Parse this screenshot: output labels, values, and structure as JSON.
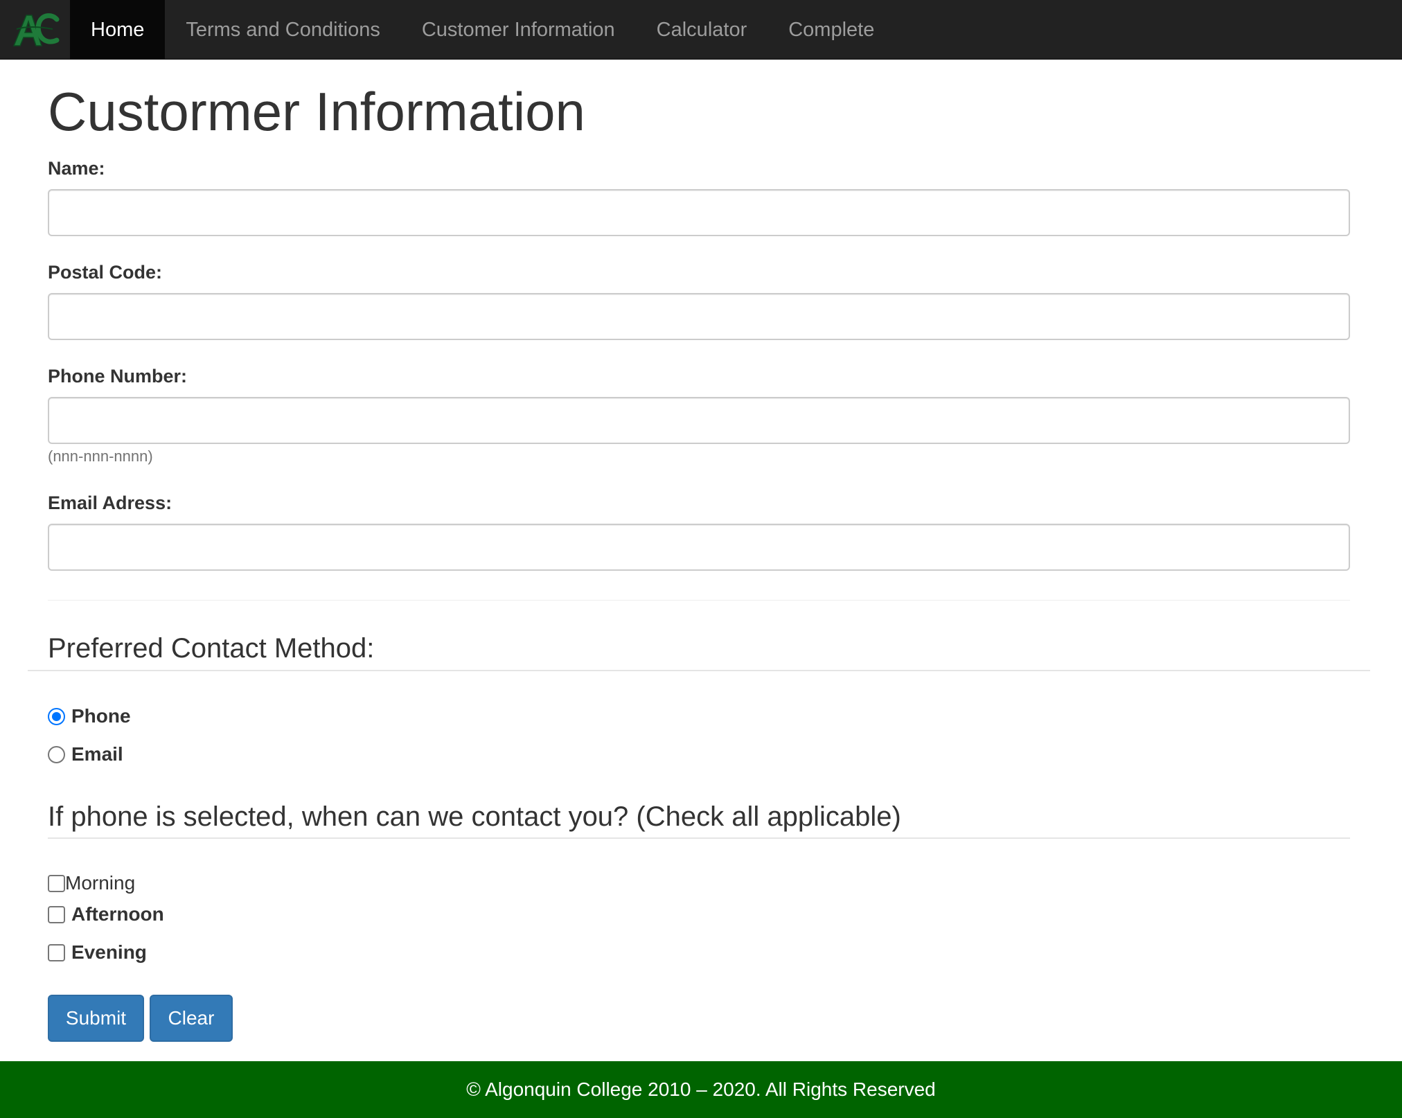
{
  "navbar": {
    "logo_alt": "AC",
    "items": [
      {
        "label": "Home",
        "active": true
      },
      {
        "label": "Terms and Conditions",
        "active": false
      },
      {
        "label": "Customer Information",
        "active": false
      },
      {
        "label": "Calculator",
        "active": false
      },
      {
        "label": "Complete",
        "active": false
      }
    ]
  },
  "page": {
    "title": "Custormer Information"
  },
  "form": {
    "name_label": "Name:",
    "name_value": "",
    "postal_label": "Postal Code:",
    "postal_value": "",
    "phone_label": "Phone Number:",
    "phone_value": "",
    "phone_help": "(nnn-nnn-nnnn)",
    "email_label": "Email Adress:",
    "email_value": ""
  },
  "contact_method": {
    "heading": "Preferred Contact Method:",
    "options": [
      {
        "label": "Phone",
        "checked": true
      },
      {
        "label": "Email",
        "checked": false
      }
    ]
  },
  "contact_times": {
    "heading": "If phone is selected, when can we contact you? (Check all applicable)",
    "options": [
      {
        "label": "Morning",
        "checked": false
      },
      {
        "label": "Afternoon",
        "checked": false
      },
      {
        "label": "Evening",
        "checked": false
      }
    ]
  },
  "buttons": {
    "submit_label": "Submit",
    "clear_label": "Clear"
  },
  "footer": {
    "text": "© Algonquin College 2010 – 2020. All Rights Reserved"
  },
  "colors": {
    "navbar_bg": "#222222",
    "footer_bg": "#006400",
    "button_bg": "#337ab7",
    "logo_green": "#1f7a3a"
  }
}
